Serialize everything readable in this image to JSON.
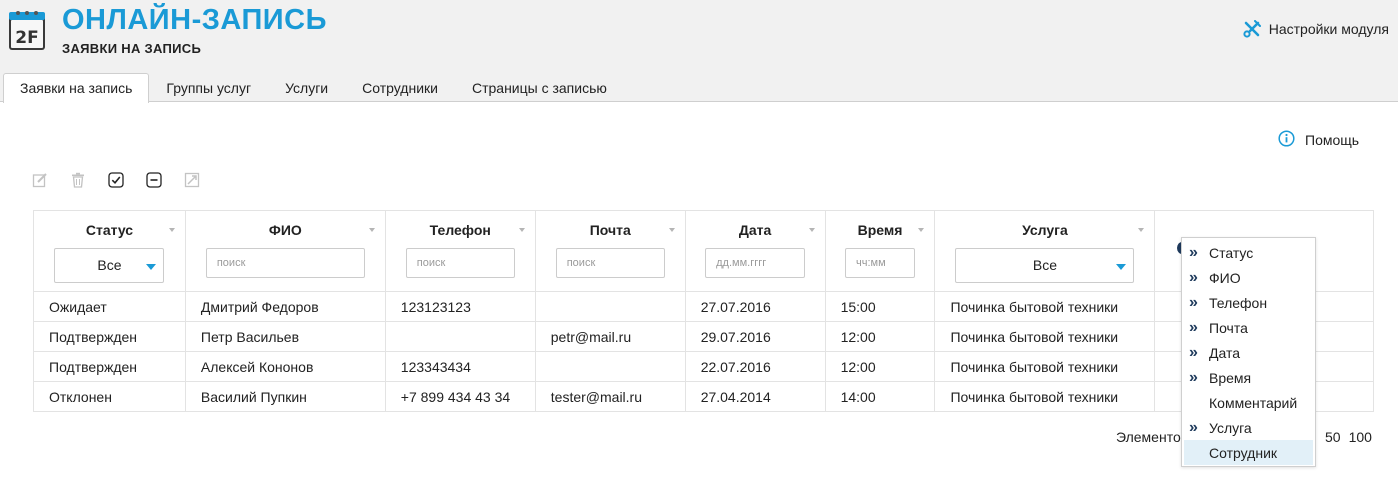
{
  "header": {
    "icon_text": "2F",
    "title": "ОНЛАЙН-ЗАПИСЬ",
    "subtitle": "ЗАЯВКИ НА ЗАПИСЬ",
    "settings_label": "Настройки модуля",
    "accent_color": "#1a9ad6"
  },
  "tabs": [
    {
      "label": "Заявки на запись",
      "active": true
    },
    {
      "label": "Группы услуг",
      "active": false
    },
    {
      "label": "Услуги",
      "active": false
    },
    {
      "label": "Сотрудники",
      "active": false
    },
    {
      "label": "Страницы с записью",
      "active": false
    }
  ],
  "help_label": "Помощь",
  "toolbar": {
    "icons": [
      "edit-icon",
      "delete-icon",
      "check-all-icon",
      "uncheck-all-icon",
      "export-icon"
    ]
  },
  "table": {
    "columns": [
      {
        "label": "Статус",
        "filter_type": "select",
        "filter_value": "Все"
      },
      {
        "label": "ФИО",
        "filter_type": "text",
        "placeholder": "поиск"
      },
      {
        "label": "Телефон",
        "filter_type": "text",
        "placeholder": "поиск"
      },
      {
        "label": "Почта",
        "filter_type": "text",
        "placeholder": "поиск"
      },
      {
        "label": "Дата",
        "filter_type": "text",
        "placeholder": "дд.мм.гггг"
      },
      {
        "label": "Время",
        "filter_type": "text",
        "placeholder": "чч:мм"
      },
      {
        "label": "Услуга",
        "filter_type": "select",
        "filter_value": "Все"
      }
    ],
    "rows": [
      [
        "Ожидает",
        "Дмитрий Федоров",
        "123123123",
        "",
        "27.07.2016",
        "15:00",
        "Починка бытовой техники"
      ],
      [
        "Подтвержден",
        "Петр Васильев",
        "",
        "petr@mail.ru",
        "29.07.2016",
        "12:00",
        "Починка бытовой техники"
      ],
      [
        "Подтвержден",
        "Алексей Кононов",
        "123343434",
        "",
        "22.07.2016",
        "12:00",
        "Починка бытовой техники"
      ],
      [
        "Отклонен",
        "Василий Пупкин",
        "+7 899 434 43 34",
        "tester@mail.ru",
        "27.04.2014",
        "14:00",
        "Починка бытовой техники"
      ]
    ]
  },
  "column_menu": [
    {
      "label": "Статус",
      "checked": true
    },
    {
      "label": "ФИО",
      "checked": true
    },
    {
      "label": "Телефон",
      "checked": true
    },
    {
      "label": "Почта",
      "checked": true
    },
    {
      "label": "Дата",
      "checked": true
    },
    {
      "label": "Время",
      "checked": true
    },
    {
      "label": "Комментарий",
      "checked": false
    },
    {
      "label": "Услуга",
      "checked": true
    },
    {
      "label": "Сотрудник",
      "checked": false,
      "highlighted": true
    }
  ],
  "pager": {
    "label": "Элементов",
    "options": [
      "50",
      "100"
    ]
  }
}
